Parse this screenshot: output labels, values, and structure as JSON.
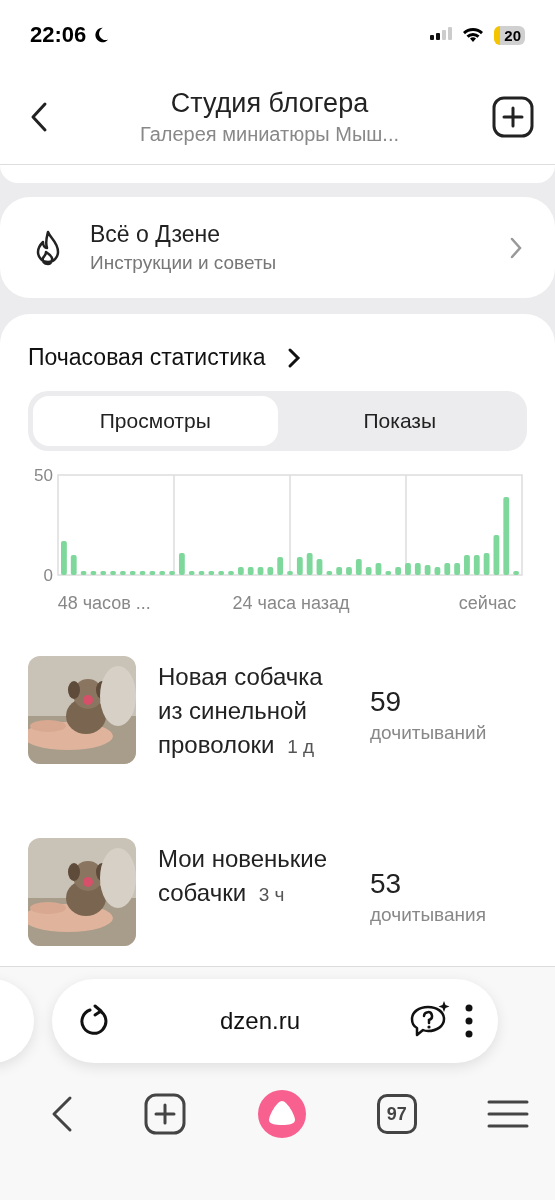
{
  "status_bar": {
    "time": "22:06",
    "battery": "20"
  },
  "header": {
    "title": "Студия блогера",
    "subtitle": "Галерея миниатюры Мыш..."
  },
  "info_card": {
    "title": "Всё о Дзене",
    "subtitle": "Инструкции и советы"
  },
  "stats": {
    "title": "Почасовая статистика",
    "tabs": [
      {
        "label": "Просмотры",
        "selected": true
      },
      {
        "label": "Показы",
        "selected": false
      }
    ],
    "chart_data": {
      "type": "bar",
      "grid": true,
      "ylim": [
        0,
        50
      ],
      "yticks": [
        0,
        50
      ],
      "categories": [
        null,
        null,
        null,
        null,
        "48 часов ...",
        null,
        null,
        null,
        null,
        null,
        null,
        null,
        null,
        null,
        null,
        null,
        null,
        null,
        null,
        null,
        null,
        null,
        null,
        "24 часа назад",
        null,
        null,
        null,
        null,
        null,
        null,
        null,
        null,
        null,
        null,
        null,
        null,
        null,
        null,
        null,
        null,
        null,
        null,
        null,
        "сейчас",
        null,
        null,
        null
      ],
      "series": [
        {
          "color": "#7ed89b",
          "values": [
            17,
            10,
            2,
            2,
            2,
            2,
            2,
            2,
            2,
            2,
            2,
            2,
            11,
            2,
            2,
            2,
            2,
            2,
            4,
            4,
            4,
            4,
            9,
            2,
            9,
            11,
            8,
            2,
            4,
            4,
            8,
            4,
            6,
            2,
            4,
            6,
            6,
            5,
            4,
            6,
            6,
            10,
            10,
            11,
            20,
            39,
            2
          ]
        }
      ]
    }
  },
  "articles": [
    {
      "title": "Новая собачка из синельной проволоки",
      "age": "1 д",
      "count": "59",
      "count_label": "дочитываний"
    },
    {
      "title": "Мои новенькие собачки",
      "age": "3 ч",
      "count": "53",
      "count_label": "дочитывания"
    }
  ],
  "browser": {
    "url": "dzen.ru",
    "tabs_count": "97"
  }
}
